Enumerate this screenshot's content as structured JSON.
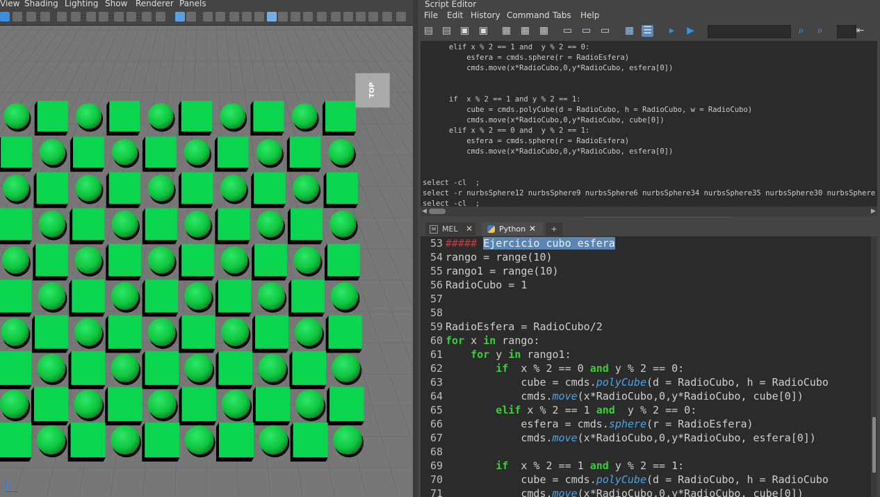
{
  "left_panel": {
    "menu": [
      "View",
      "Shading",
      "Lighting",
      "Show",
      "Renderer",
      "Panels"
    ],
    "viewcube_label": "TOP",
    "axis_label": "z",
    "colors": {
      "cube": "#0bd44f",
      "sphere": "#0fc43e",
      "viewport_bg": "#777777",
      "grid": "#6c6c6c"
    },
    "scene": {
      "grid_columns": 10,
      "grid_rows": 10,
      "pattern": "checkerboard of cubes and spheres",
      "cube_color": "green",
      "sphere_color": "green"
    }
  },
  "script_editor": {
    "title": "Script Editor",
    "menu": [
      "File",
      "Edit",
      "History",
      "Command",
      "Tabs",
      "Help"
    ],
    "toolbar_icons": [
      "open-script-icon",
      "source-script-icon",
      "save-script-icon",
      "save-to-shelf-icon",
      "clear-history-icon",
      "clear-input-icon",
      "clear-all-icon",
      "show-history-icon",
      "show-input-icon",
      "show-both-icon",
      "echo-all-icon",
      "line-numbers-icon",
      "execute-all-icon",
      "execute-icon",
      "search-icon",
      "search-next-icon",
      "goto-line-icon"
    ],
    "history_lines": [
      "      elif x % 2 == 1 and  y % 2 == 0:",
      "          esfera = cmds.sphere(r = RadioEsfera)",
      "          cmds.move(x*RadioCubo,0,y*RadioCubo, esfera[0])",
      "",
      "",
      "      if  x % 2 == 1 and y % 2 == 1:",
      "          cube = cmds.polyCube(d = RadioCubo, h = RadioCubo, w = RadioCubo)",
      "          cmds.move(x*RadioCubo,0,y*RadioCubo, cube[0])",
      "      elif x % 2 == 0 and  y % 2 == 1:",
      "          esfera = cmds.sphere(r = RadioEsfera)",
      "          cmds.move(x*RadioCubo,0,y*RadioCubo, esfera[0])",
      "",
      "",
      "select -cl  ;",
      "select -r nurbsSphere12 nurbsSphere9 nurbsSphere6 nurbsSphere34 nurbsSphere35 nurbsSphere30 nurbsSphere",
      "select -cl  ;"
    ],
    "tabs": [
      {
        "label": "MEL",
        "icon": "mel-icon",
        "active": false
      },
      {
        "label": "Python",
        "icon": "python-icon",
        "active": true
      }
    ],
    "add_tab_label": "+",
    "code_lines": [
      {
        "n": "53",
        "tokens": [
          {
            "t": "##### ",
            "c": "cm"
          },
          {
            "t": "Ejercicio cubo esfera",
            "c": "sel"
          }
        ]
      },
      {
        "n": "54",
        "tokens": [
          {
            "t": "rango = range(10)",
            "c": ""
          }
        ]
      },
      {
        "n": "55",
        "tokens": [
          {
            "t": "rango1 = range(10)",
            "c": ""
          }
        ]
      },
      {
        "n": "56",
        "tokens": [
          {
            "t": "RadioCubo = 1",
            "c": ""
          }
        ]
      },
      {
        "n": "57",
        "tokens": []
      },
      {
        "n": "58",
        "tokens": []
      },
      {
        "n": "59",
        "tokens": [
          {
            "t": "RadioEsfera = RadioCubo/2",
            "c": ""
          }
        ]
      },
      {
        "n": "60",
        "tokens": [
          {
            "t": "for",
            "c": "kw"
          },
          {
            "t": " x ",
            "c": ""
          },
          {
            "t": "in",
            "c": "kw"
          },
          {
            "t": " rango:",
            "c": ""
          }
        ]
      },
      {
        "n": "61",
        "tokens": [
          {
            "t": "    ",
            "c": ""
          },
          {
            "t": "for",
            "c": "kw"
          },
          {
            "t": " y ",
            "c": ""
          },
          {
            "t": "in",
            "c": "kw"
          },
          {
            "t": " rango1:",
            "c": ""
          }
        ]
      },
      {
        "n": "62",
        "tokens": [
          {
            "t": "        ",
            "c": ""
          },
          {
            "t": "if",
            "c": "kw"
          },
          {
            "t": "  x % 2 == 0 ",
            "c": ""
          },
          {
            "t": "and",
            "c": "kw"
          },
          {
            "t": " y % 2 == 0:",
            "c": ""
          }
        ]
      },
      {
        "n": "63",
        "tokens": [
          {
            "t": "            cube = cmds.",
            "c": ""
          },
          {
            "t": "polyCube",
            "c": "fn"
          },
          {
            "t": "(d = RadioCubo, h = RadioCubo",
            "c": ""
          }
        ]
      },
      {
        "n": "64",
        "tokens": [
          {
            "t": "            cmds.",
            "c": ""
          },
          {
            "t": "move",
            "c": "fn"
          },
          {
            "t": "(x*RadioCubo,0,y*RadioCubo, cube[0])",
            "c": ""
          }
        ]
      },
      {
        "n": "65",
        "tokens": [
          {
            "t": "        ",
            "c": ""
          },
          {
            "t": "elif",
            "c": "kw"
          },
          {
            "t": " x % 2 == 1 ",
            "c": ""
          },
          {
            "t": "and",
            "c": "kw"
          },
          {
            "t": "  y % 2 == 0:",
            "c": ""
          }
        ]
      },
      {
        "n": "66",
        "tokens": [
          {
            "t": "            esfera = cmds.",
            "c": ""
          },
          {
            "t": "sphere",
            "c": "fn"
          },
          {
            "t": "(r = RadioEsfera)",
            "c": ""
          }
        ]
      },
      {
        "n": "67",
        "tokens": [
          {
            "t": "            cmds.",
            "c": ""
          },
          {
            "t": "move",
            "c": "fn"
          },
          {
            "t": "(x*RadioCubo,0,y*RadioCubo, esfera[0])",
            "c": ""
          }
        ]
      },
      {
        "n": "68",
        "tokens": []
      },
      {
        "n": "69",
        "tokens": [
          {
            "t": "        ",
            "c": ""
          },
          {
            "t": "if",
            "c": "kw"
          },
          {
            "t": "  x % 2 == 1 ",
            "c": ""
          },
          {
            "t": "and",
            "c": "kw"
          },
          {
            "t": " y % 2 == 1:",
            "c": ""
          }
        ]
      },
      {
        "n": "70",
        "tokens": [
          {
            "t": "            cube = cmds.",
            "c": ""
          },
          {
            "t": "polyCube",
            "c": "fn"
          },
          {
            "t": "(d = RadioCubo, h = RadioCubo",
            "c": ""
          }
        ]
      },
      {
        "n": "71",
        "tokens": [
          {
            "t": "            cmds.",
            "c": ""
          },
          {
            "t": "move",
            "c": "fn"
          },
          {
            "t": "(x*RadioCubo,0,y*RadioCubo, cube[0])",
            "c": ""
          }
        ]
      }
    ]
  }
}
